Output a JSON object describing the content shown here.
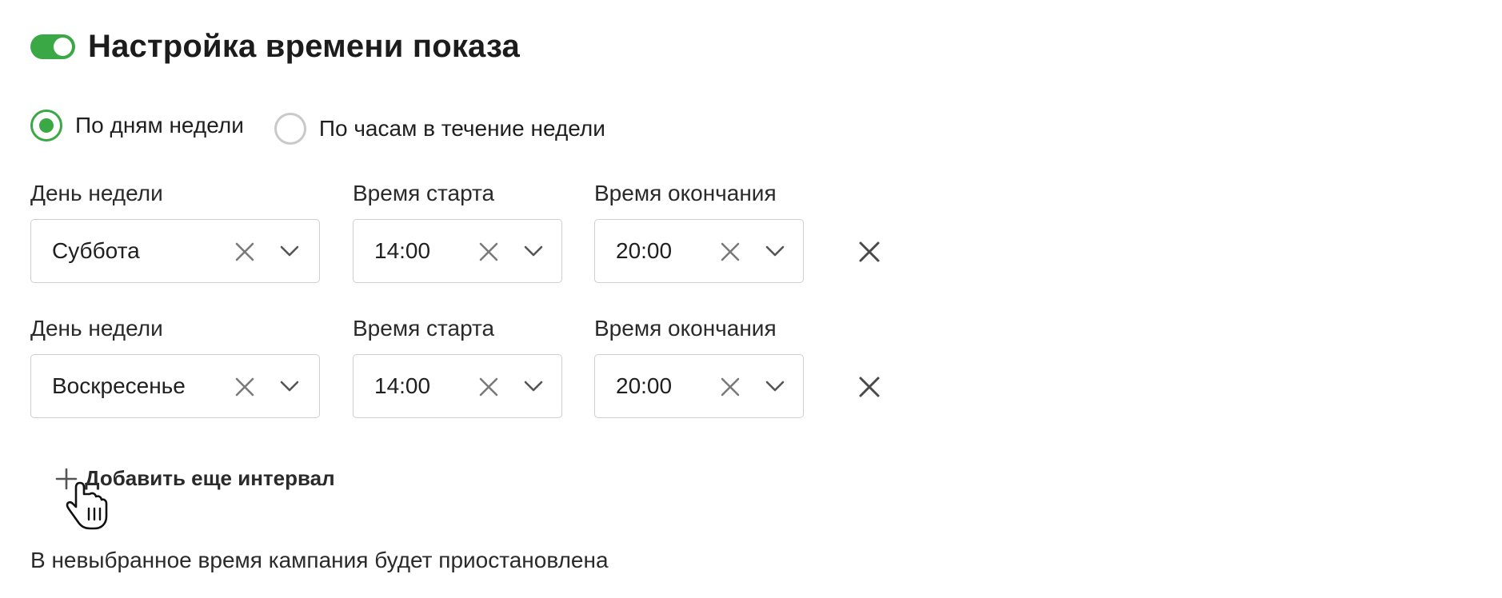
{
  "header": {
    "title": "Настройка времени показа",
    "toggle_on": true,
    "accent_color": "#3aa845"
  },
  "mode": {
    "options": [
      {
        "label": "По дням недели",
        "selected": true
      },
      {
        "label": "По часам в течение недели",
        "selected": false
      }
    ]
  },
  "intervals": [
    {
      "day_label": "День недели",
      "day_value": "Суббота",
      "start_label": "Время старта",
      "start_value": "14:00",
      "end_label": "Время окончания",
      "end_value": "20:00"
    },
    {
      "day_label": "День недели",
      "day_value": "Воскресенье",
      "start_label": "Время старта",
      "start_value": "14:00",
      "end_label": "Время окончания",
      "end_value": "20:00"
    }
  ],
  "actions": {
    "add_interval_label": "Добавить еще интервал"
  },
  "note": "В невыбранное время кампания будет приостановлена",
  "icons": {
    "clear": "close-icon",
    "dropdown": "chevron-down-icon",
    "remove": "close-icon",
    "add": "plus-icon",
    "cursor": "hand-pointer-icon"
  }
}
